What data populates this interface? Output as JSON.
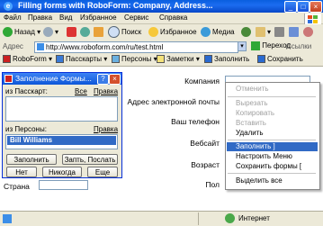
{
  "window": {
    "title": "Filling forms with RoboForm: Company, Address..."
  },
  "menu": [
    "Файл",
    "Правка",
    "Вид",
    "Избранное",
    "Сервис",
    "Справка"
  ],
  "toolbar": {
    "back": "Назад",
    "search": "Поиск",
    "favorites": "Избранное",
    "media": "Медиа"
  },
  "address": {
    "label": "Адрес",
    "url": "http://www.roboform.com/ru/test.html",
    "go": "Переход",
    "links": "Ссылки"
  },
  "roboform_bar": {
    "roboform": "RoboForm",
    "passcards": "Пасскарты",
    "identities": "Персоны",
    "notes": "Заметки",
    "fill": "Заполнить",
    "save": "Сохранить"
  },
  "form": {
    "company": "Компания",
    "email": "Адрес электронной почты",
    "phone": "Ваш телефон",
    "website": "Вебсайт",
    "age": "Возраст",
    "sex": "Пол",
    "country": "Страна"
  },
  "panel": {
    "title": "Заполнение Формы...",
    "from_passcard": "из Пасскарт:",
    "all": "Все",
    "edit": "Правка",
    "from_identities": "из Персоны:",
    "identity_item": "Bill Williams",
    "fill": "Заполнить",
    "fill_send": "Запть, Послать",
    "no": "Нет",
    "never": "Никогда",
    "more": "Еще"
  },
  "context_menu": {
    "undo": "Отменить",
    "cut": "Вырезать",
    "copy": "Копировать",
    "paste": "Вставить",
    "delete": "Удалить",
    "fill": "Заполнить ]",
    "customize": "Настроить Меню",
    "save_form": "Сохранить формы [",
    "select_all": "Выделить все"
  },
  "status": {
    "zone": "Интернет"
  },
  "colors": {
    "accent": "#0a5fdf",
    "selection": "#316ac5",
    "roboform_red": "#cc2020"
  }
}
